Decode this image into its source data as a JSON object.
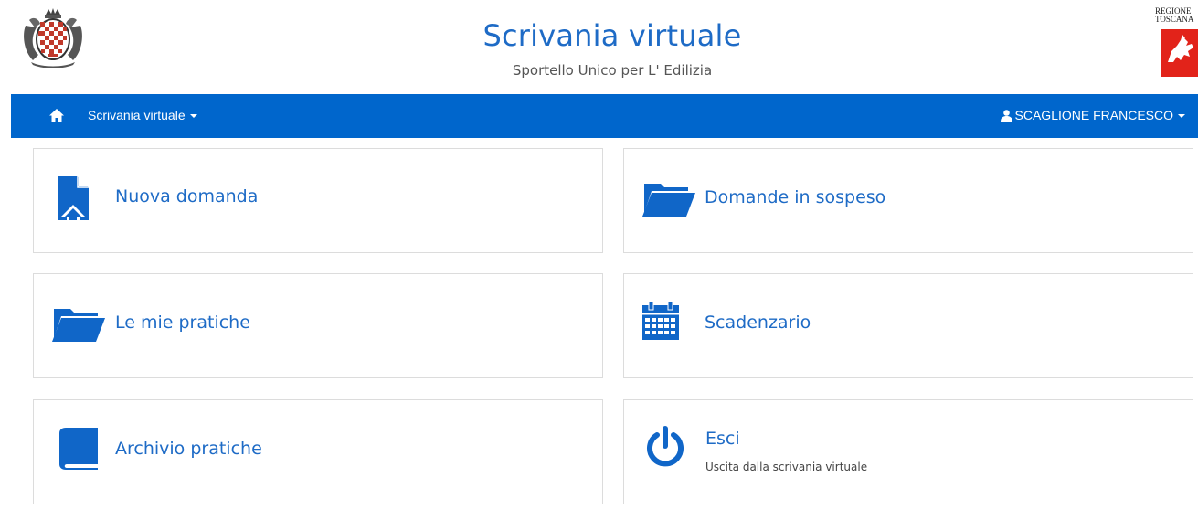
{
  "header": {
    "title": "Scrivania virtuale",
    "subtitle": "Sportello Unico per L' Edilizia",
    "right_logo_text_line1": "REGIONE",
    "right_logo_text_line2": "TOSCANA"
  },
  "navbar": {
    "home_icon": "home-icon",
    "menu_label": "Scrivania virtuale",
    "user_label": "SCAGLIONE FRANCESCO"
  },
  "cards": [
    {
      "label": "Nuova domanda",
      "icon": "file-upload-icon"
    },
    {
      "label": "Domande in sospeso",
      "icon": "folder-open-icon"
    },
    {
      "label": "Le mie pratiche",
      "icon": "folder-open-icon"
    },
    {
      "label": "Scadenzario",
      "icon": "calendar-icon"
    },
    {
      "label": "Archivio pratiche",
      "icon": "book-icon"
    },
    {
      "label": "Esci",
      "icon": "power-icon",
      "description": "Uscita dalla scrivania virtuale"
    }
  ],
  "colors": {
    "primary": "#0066cc",
    "link": "#1e6bc6",
    "border": "#dcdcdc"
  }
}
